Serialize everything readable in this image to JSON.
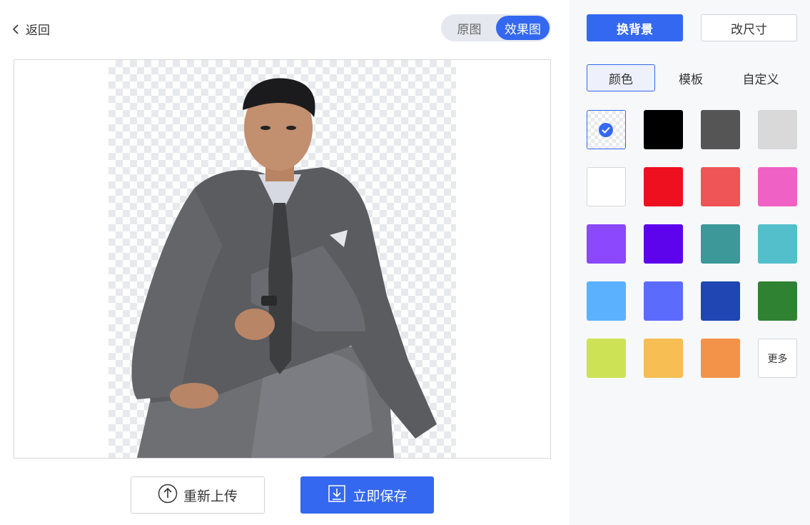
{
  "header": {
    "back_label": "返回",
    "view_toggle": {
      "options": [
        "原图",
        "效果图"
      ],
      "active": "效果图"
    }
  },
  "actions": {
    "reupload_label": "重新上传",
    "save_label": "立即保存"
  },
  "sidebar": {
    "tabs": {
      "background": "换背景",
      "resize": "改尺寸",
      "active": "换背景"
    },
    "subtabs": {
      "color": "颜色",
      "template": "模板",
      "custom": "自定义",
      "active": "颜色"
    },
    "swatches": [
      {
        "name": "transparent",
        "color": "transparent",
        "selected": true
      },
      {
        "name": "black",
        "color": "#000000"
      },
      {
        "name": "dark-gray",
        "color": "#555555"
      },
      {
        "name": "light-gray",
        "color": "#d9d9d9"
      },
      {
        "name": "white",
        "color": "#ffffff"
      },
      {
        "name": "red",
        "color": "#ee0f1f"
      },
      {
        "name": "light-red",
        "color": "#ef5457"
      },
      {
        "name": "pink",
        "color": "#f061c5"
      },
      {
        "name": "purple",
        "color": "#8b48fc"
      },
      {
        "name": "violet",
        "color": "#5e04ed"
      },
      {
        "name": "teal",
        "color": "#3c9899"
      },
      {
        "name": "cyan",
        "color": "#53bfca"
      },
      {
        "name": "sky-blue",
        "color": "#5bb1fe"
      },
      {
        "name": "periwinkle",
        "color": "#5b6cfc"
      },
      {
        "name": "navy",
        "color": "#1f46b3"
      },
      {
        "name": "green",
        "color": "#2e8232"
      },
      {
        "name": "lime",
        "color": "#cde355"
      },
      {
        "name": "yellow",
        "color": "#f6be53"
      },
      {
        "name": "orange",
        "color": "#f39249"
      }
    ],
    "more_label": "更多"
  },
  "colors": {
    "accent": "#3468f0"
  }
}
